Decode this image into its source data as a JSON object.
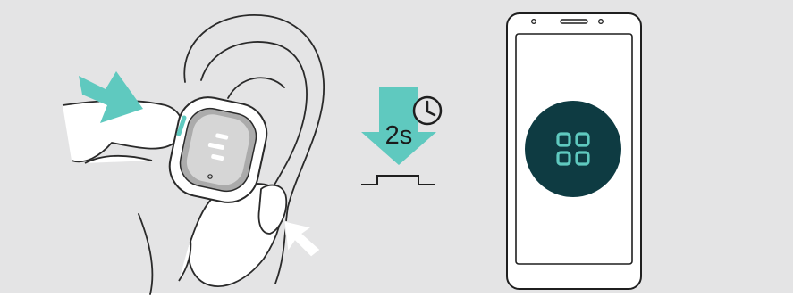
{
  "illustration": {
    "press_duration_label": "2s",
    "icons": [
      "ear-icon",
      "earbud-icon",
      "press-arrow-icon",
      "clock-icon",
      "press-down-arrow-icon",
      "button-press-icon",
      "smartphone-icon",
      "app-grid-icon"
    ]
  },
  "colors": {
    "background_panel": "#e4e4e5",
    "accent_teal": "#5fc9bf",
    "app_circle": "#0e3b42",
    "outline": "#1f1f1f"
  }
}
